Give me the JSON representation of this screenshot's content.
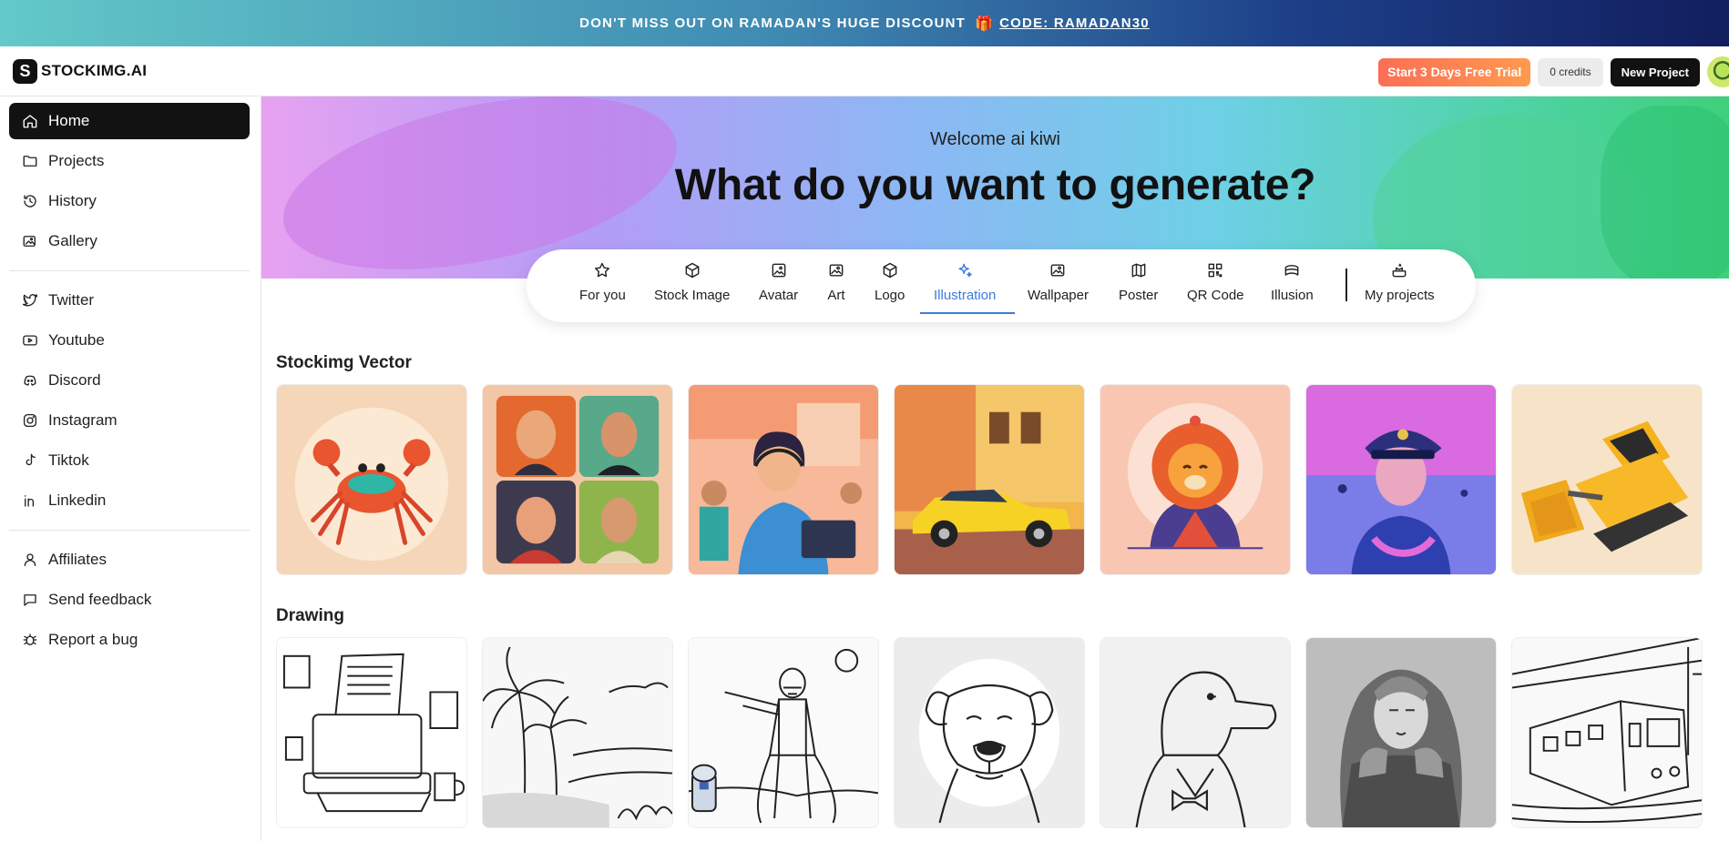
{
  "promo": {
    "text": "DON'T MISS OUT ON RAMADAN'S HUGE DISCOUNT",
    "gift_icon": "gift-icon",
    "code": "CODE: RAMADAN30"
  },
  "header": {
    "brand_mark": "S",
    "brand_name": "STOCKIMG.AI",
    "trial_label": "Start 3 Days Free Trial",
    "credits_label": "0 credits",
    "new_project_label": "New Project"
  },
  "sidebar": {
    "main": [
      {
        "label": "Home",
        "icon": "home-icon",
        "active": true
      },
      {
        "label": "Projects",
        "icon": "folder-icon"
      },
      {
        "label": "History",
        "icon": "history-icon"
      },
      {
        "label": "Gallery",
        "icon": "gallery-icon"
      }
    ],
    "social": [
      {
        "label": "Twitter",
        "icon": "twitter-icon"
      },
      {
        "label": "Youtube",
        "icon": "youtube-icon"
      },
      {
        "label": "Discord",
        "icon": "discord-icon"
      },
      {
        "label": "Instagram",
        "icon": "instagram-icon"
      },
      {
        "label": "Tiktok",
        "icon": "tiktok-icon"
      },
      {
        "label": "Linkedin",
        "icon": "linkedin-icon"
      }
    ],
    "support": [
      {
        "label": "Affiliates",
        "icon": "user-icon"
      },
      {
        "label": "Send feedback",
        "icon": "feedback-icon"
      },
      {
        "label": "Report a bug",
        "icon": "bug-icon"
      }
    ]
  },
  "hero": {
    "welcome": "Welcome ai kiwi",
    "headline": "What do you want to generate?"
  },
  "categories": [
    {
      "label": "For you",
      "icon": "star-icon"
    },
    {
      "label": "Stock Image",
      "icon": "cube-icon"
    },
    {
      "label": "Avatar",
      "icon": "image-icon"
    },
    {
      "label": "Art",
      "icon": "image-icon"
    },
    {
      "label": "Logo",
      "icon": "cube-icon"
    },
    {
      "label": "Illustration",
      "icon": "sparkles-icon",
      "active": true
    },
    {
      "label": "Wallpaper",
      "icon": "image-icon"
    },
    {
      "label": "Poster",
      "icon": "map-icon"
    },
    {
      "label": "QR Code",
      "icon": "qr-code-icon"
    },
    {
      "label": "Illusion",
      "icon": "illusion-icon"
    },
    {
      "label": "My projects",
      "icon": "my-projects-icon"
    }
  ],
  "sections": [
    {
      "title": "Stockimg Vector",
      "tiles": [
        {
          "name": "crab-illustration",
          "bg": "#f6d6b8"
        },
        {
          "name": "portraits-illustration",
          "bg": "#f3c7a6"
        },
        {
          "name": "call-center-illustration",
          "bg": "#f7b99a"
        },
        {
          "name": "yellow-car-illustration",
          "bg": "#f2b64a"
        },
        {
          "name": "lion-illustration",
          "bg": "#f9c6b2"
        },
        {
          "name": "pilot-illustration",
          "bg": "#d96ae0"
        },
        {
          "name": "bulldozer-illustration",
          "bg": "#f7e4c8"
        }
      ]
    },
    {
      "title": "Drawing",
      "tiles": [
        {
          "name": "printer-drawing",
          "bg": "#ffffff"
        },
        {
          "name": "palm-beach-drawing",
          "bg": "#f7f7f7"
        },
        {
          "name": "stormtrooper-drawing",
          "bg": "#fafafa"
        },
        {
          "name": "dog-drawing",
          "bg": "#ececec"
        },
        {
          "name": "duck-drawing",
          "bg": "#f1f1f1"
        },
        {
          "name": "warrior-drawing",
          "bg": "#bdbdbd"
        },
        {
          "name": "train-drawing",
          "bg": "#f9f9f9"
        }
      ]
    }
  ]
}
